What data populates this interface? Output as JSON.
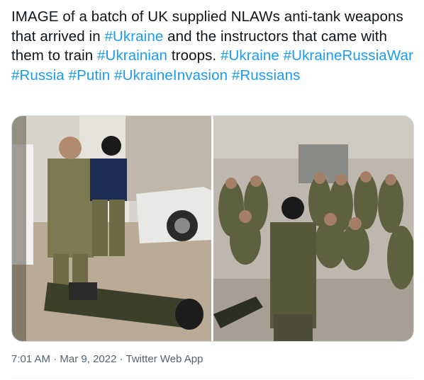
{
  "tweet": {
    "text_segments": [
      {
        "text": "IMAGE of a batch of UK supplied NLAWs anti-tank weapons that arrived in ",
        "type": "text"
      },
      {
        "text": "#Ukraine",
        "type": "hashtag"
      },
      {
        "text": " and the instructors that came with them to train ",
        "type": "text"
      },
      {
        "text": "#Ukrainian",
        "type": "hashtag"
      },
      {
        "text": " troops. ",
        "type": "text"
      },
      {
        "text": "#Ukraine",
        "type": "hashtag"
      },
      {
        "text": " ",
        "type": "text"
      },
      {
        "text": "#UkraineRussiaWar",
        "type": "hashtag"
      },
      {
        "text": " ",
        "type": "text"
      },
      {
        "text": "#Russia",
        "type": "hashtag"
      },
      {
        "text": " ",
        "type": "text"
      },
      {
        "text": "#Putin",
        "type": "hashtag"
      },
      {
        "text": " ",
        "type": "text"
      },
      {
        "text": "#UkraineInvasion",
        "type": "hashtag"
      },
      {
        "text": " ",
        "type": "text"
      },
      {
        "text": "#Russians",
        "type": "hashtag"
      }
    ],
    "time": "7:01 AM",
    "separator": "·",
    "date": "Mar 9, 2022",
    "source": "Twitter Web App"
  },
  "colors": {
    "text": "#0f1419",
    "hashtag": "#1d9bf0",
    "meta": "#536471",
    "border": "#cfd9de"
  }
}
